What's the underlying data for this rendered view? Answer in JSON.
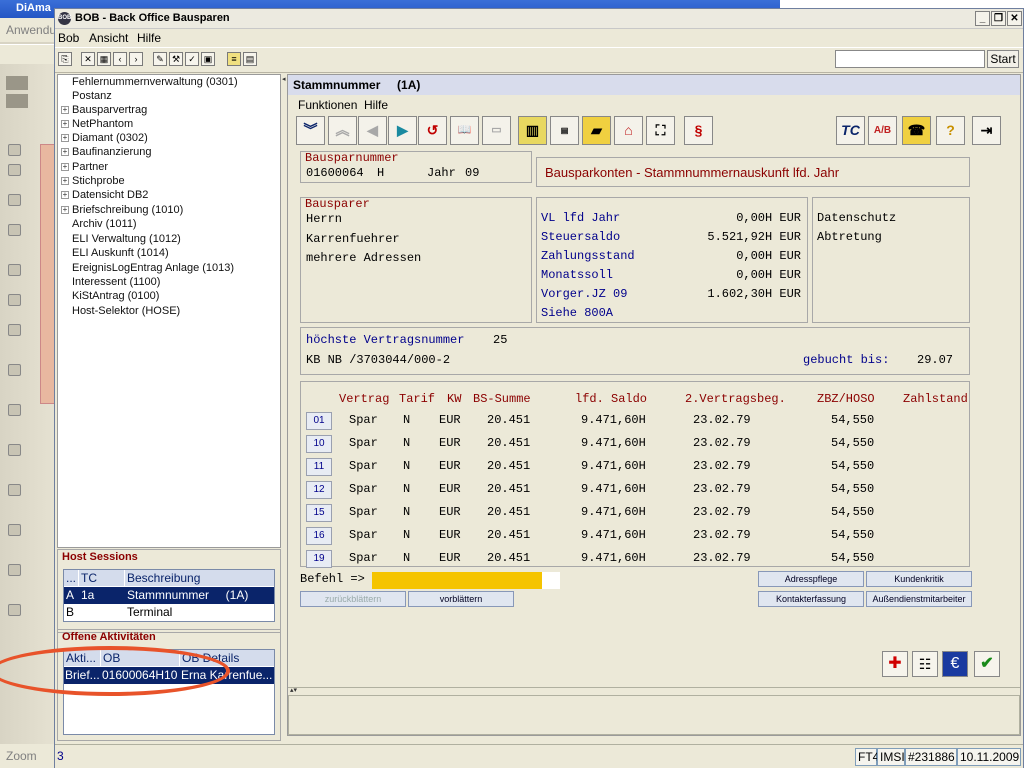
{
  "background_app": {
    "title": "DiAma",
    "menu_item": "Anwendu",
    "zoom_label": "Zoom"
  },
  "window": {
    "title": "BOB - Back Office Bausparen",
    "menu": [
      "Bob",
      "Ansicht",
      "Hilfe"
    ],
    "start_label": "Start",
    "search_value": ""
  },
  "tree": {
    "items": [
      {
        "label": "Fehlernummernverwaltung (0301)",
        "expandable": false
      },
      {
        "label": "Postanz",
        "expandable": false
      },
      {
        "label": "Bausparvertrag",
        "expandable": true
      },
      {
        "label": "NetPhantom",
        "expandable": true
      },
      {
        "label": "Diamant (0302)",
        "expandable": true
      },
      {
        "label": "Baufinanzierung",
        "expandable": true
      },
      {
        "label": "Partner",
        "expandable": true
      },
      {
        "label": "Stichprobe",
        "expandable": true
      },
      {
        "label": "Datensicht DB2",
        "expandable": true
      },
      {
        "label": "Briefschreibung (1010)",
        "expandable": true
      },
      {
        "label": "Archiv (1011)",
        "expandable": false
      },
      {
        "label": "ELI Verwaltung (1012)",
        "expandable": false
      },
      {
        "label": "ELI Auskunft (1014)",
        "expandable": false
      },
      {
        "label": "EreignisLogEntrag Anlage (1013)",
        "expandable": false
      },
      {
        "label": "Interessent (1100)",
        "expandable": false
      },
      {
        "label": "KiStAntrag (0100)",
        "expandable": false
      },
      {
        "label": "Host-Selektor (HOSE)",
        "expandable": false
      }
    ]
  },
  "host_sessions": {
    "title": "Host Sessions",
    "columns": [
      "...",
      "TC",
      "Beschreibung"
    ],
    "rows": [
      {
        "id": "A",
        "tc": "1a",
        "desc": "Stammnummer     (1A)"
      },
      {
        "id": "B",
        "tc": "",
        "desc": "Terminal"
      }
    ]
  },
  "activities": {
    "title": "Offene Aktivitäten",
    "columns": [
      "Akti...",
      "OB",
      "OB Details"
    ],
    "rows": [
      {
        "akti": "Brief...",
        "ob": "01600064H10",
        "details": "Erna Karrenfue..."
      }
    ]
  },
  "content": {
    "header": "Stammnummer     (1A)",
    "menu": [
      "Funktionen",
      "Hilfe"
    ],
    "bauspar": {
      "label": "Bausparnummer",
      "number": "01600064",
      "suffix": "H",
      "year_label": "Jahr",
      "year": "09"
    },
    "headline": "Bausparkonten - Stammnummernauskunft lfd. Jahr",
    "bausparer": {
      "label": "Bausparer",
      "lines": [
        "Herrn",
        "Karrenfuehrer",
        "mehrere Adressen"
      ]
    },
    "values": [
      {
        "label": "VL lfd Jahr",
        "value": "0,00H EUR"
      },
      {
        "label": "Steuersaldo",
        "value": "5.521,92H EUR"
      },
      {
        "label": "Zahlungsstand",
        "value": "0,00H EUR"
      },
      {
        "label": "Monatssoll",
        "value": "0,00H EUR"
      },
      {
        "label": "Vorger.JZ 09",
        "value": "1.602,30H EUR"
      },
      {
        "label": "Siehe 800A",
        "value": ""
      }
    ],
    "flags": [
      "Datenschutz",
      "Abtretung"
    ],
    "vertrag": {
      "label": "höchste Vertragsnummer",
      "value": "25",
      "kb_line": "KB NB /3703044/000-2",
      "gebucht_label": "gebucht bis:",
      "gebucht_value": "29.07"
    },
    "table": {
      "columns": [
        "Vertrag",
        "Tarif",
        "KW",
        "BS-Summe",
        "lfd. Saldo",
        "2.Vertragsbeg.",
        "ZBZ/HOSO",
        "Zahlstand"
      ],
      "rows": [
        {
          "nr": "01",
          "vertrag": "Spar",
          "tarif": "N",
          "kw": "EUR",
          "summe": "20.451",
          "saldo": "9.471,60H",
          "beg": "23.02.79",
          "zbz": "54,550"
        },
        {
          "nr": "10",
          "vertrag": "Spar",
          "tarif": "N",
          "kw": "EUR",
          "summe": "20.451",
          "saldo": "9.471,60H",
          "beg": "23.02.79",
          "zbz": "54,550"
        },
        {
          "nr": "11",
          "vertrag": "Spar",
          "tarif": "N",
          "kw": "EUR",
          "summe": "20.451",
          "saldo": "9.471,60H",
          "beg": "23.02.79",
          "zbz": "54,550"
        },
        {
          "nr": "12",
          "vertrag": "Spar",
          "tarif": "N",
          "kw": "EUR",
          "summe": "20.451",
          "saldo": "9.471,60H",
          "beg": "23.02.79",
          "zbz": "54,550"
        },
        {
          "nr": "15",
          "vertrag": "Spar",
          "tarif": "N",
          "kw": "EUR",
          "summe": "20.451",
          "saldo": "9.471,60H",
          "beg": "23.02.79",
          "zbz": "54,550"
        },
        {
          "nr": "16",
          "vertrag": "Spar",
          "tarif": "N",
          "kw": "EUR",
          "summe": "20.451",
          "saldo": "9.471,60H",
          "beg": "23.02.79",
          "zbz": "54,550"
        },
        {
          "nr": "19",
          "vertrag": "Spar",
          "tarif": "N",
          "kw": "EUR",
          "summe": "20.451",
          "saldo": "9.471,60H",
          "beg": "23.02.79",
          "zbz": "54,550"
        }
      ]
    },
    "befehl_label": "Befehl =>",
    "befehl_value": "",
    "buttons": {
      "back": "zurückblättern",
      "forward": "vorblättern",
      "adresspflege": "Adresspflege",
      "kundenkritik": "Kundenkritik",
      "kontakterfassung": "Kontakterfassung",
      "aussendienst": "Außendienstmitarbeiter"
    },
    "toolbar_right_label": "TC"
  },
  "status": {
    "left": "3",
    "fields": [
      "FT4",
      "IMSI",
      "#231886",
      "10.11.2009"
    ]
  },
  "colors": {
    "accent": "#0a246a",
    "label_red": "#8b0000",
    "value_blue": "#00008b",
    "command_yellow": "#f5c400",
    "highlight_oval": "#e8532a"
  }
}
